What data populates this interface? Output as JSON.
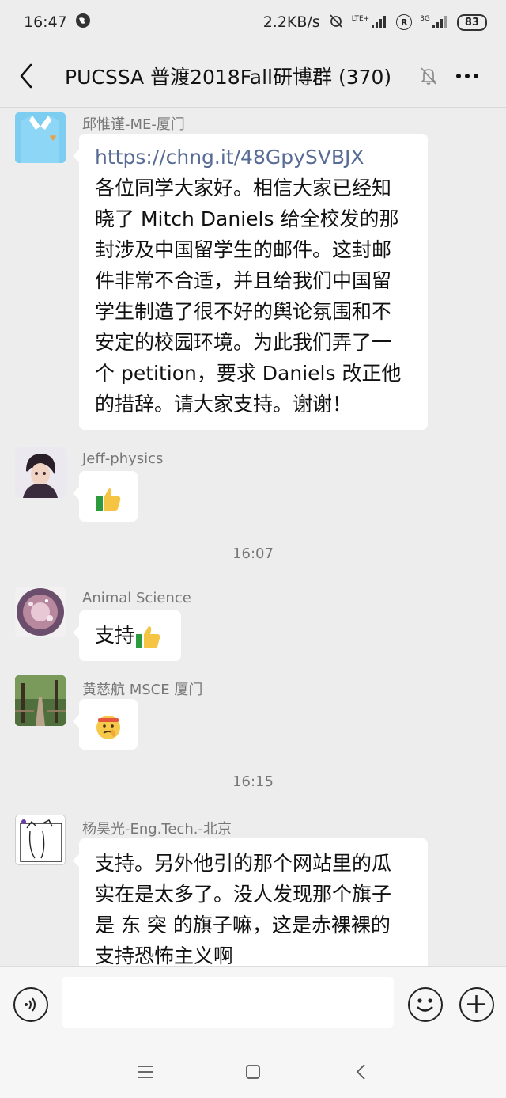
{
  "status_bar": {
    "time": "16:47",
    "speed": "2.2KB/s",
    "lte_label": "LTE+",
    "network_3g": "3G",
    "roaming": "R",
    "battery": "83"
  },
  "header": {
    "title": "PUCSSA 普渡2018Fall研博群 (370)"
  },
  "messages": [
    {
      "sender": "邱惟谨-ME-厦门",
      "link": "https://chng.it/48GpySVBJX",
      "lines": [
        "各位同学大家好。相信大家已经知",
        "晓了 Mitch Daniels 给全校发的那",
        "封涉及中国留学生的邮件。这封邮",
        "件非常不合适，并且给我们中国留",
        "学生制造了很不好的舆论氛围和不",
        "安定的校园环境。为此我们弄了一",
        "个 petition，要求 Daniels 改正他",
        "的措辞。请大家支持。谢谢！"
      ]
    },
    {
      "sender": "Jeff-physics",
      "emoji": "thumbs-up"
    },
    {
      "time": "16:07"
    },
    {
      "sender": "Animal Science",
      "text": "支持",
      "emoji": "thumbs-up"
    },
    {
      "sender": "黄慈航 MSCE 厦门",
      "emoji": "shushing-face"
    },
    {
      "time": "16:15"
    },
    {
      "sender": "杨昊光-Eng.Tech.-北京",
      "lines": [
        "支持。另外他引的那个网站里的瓜",
        "实在是太多了。没人发现那个旗子",
        "是 东 突 的旗子嘛，这是赤裸裸的",
        "支持恐怖主义啊"
      ]
    }
  ],
  "input_bar": {
    "placeholder": ""
  },
  "colors": {
    "background": "#ededed",
    "bubble": "#ffffff",
    "link": "#576b95",
    "meta_text": "#777777"
  }
}
